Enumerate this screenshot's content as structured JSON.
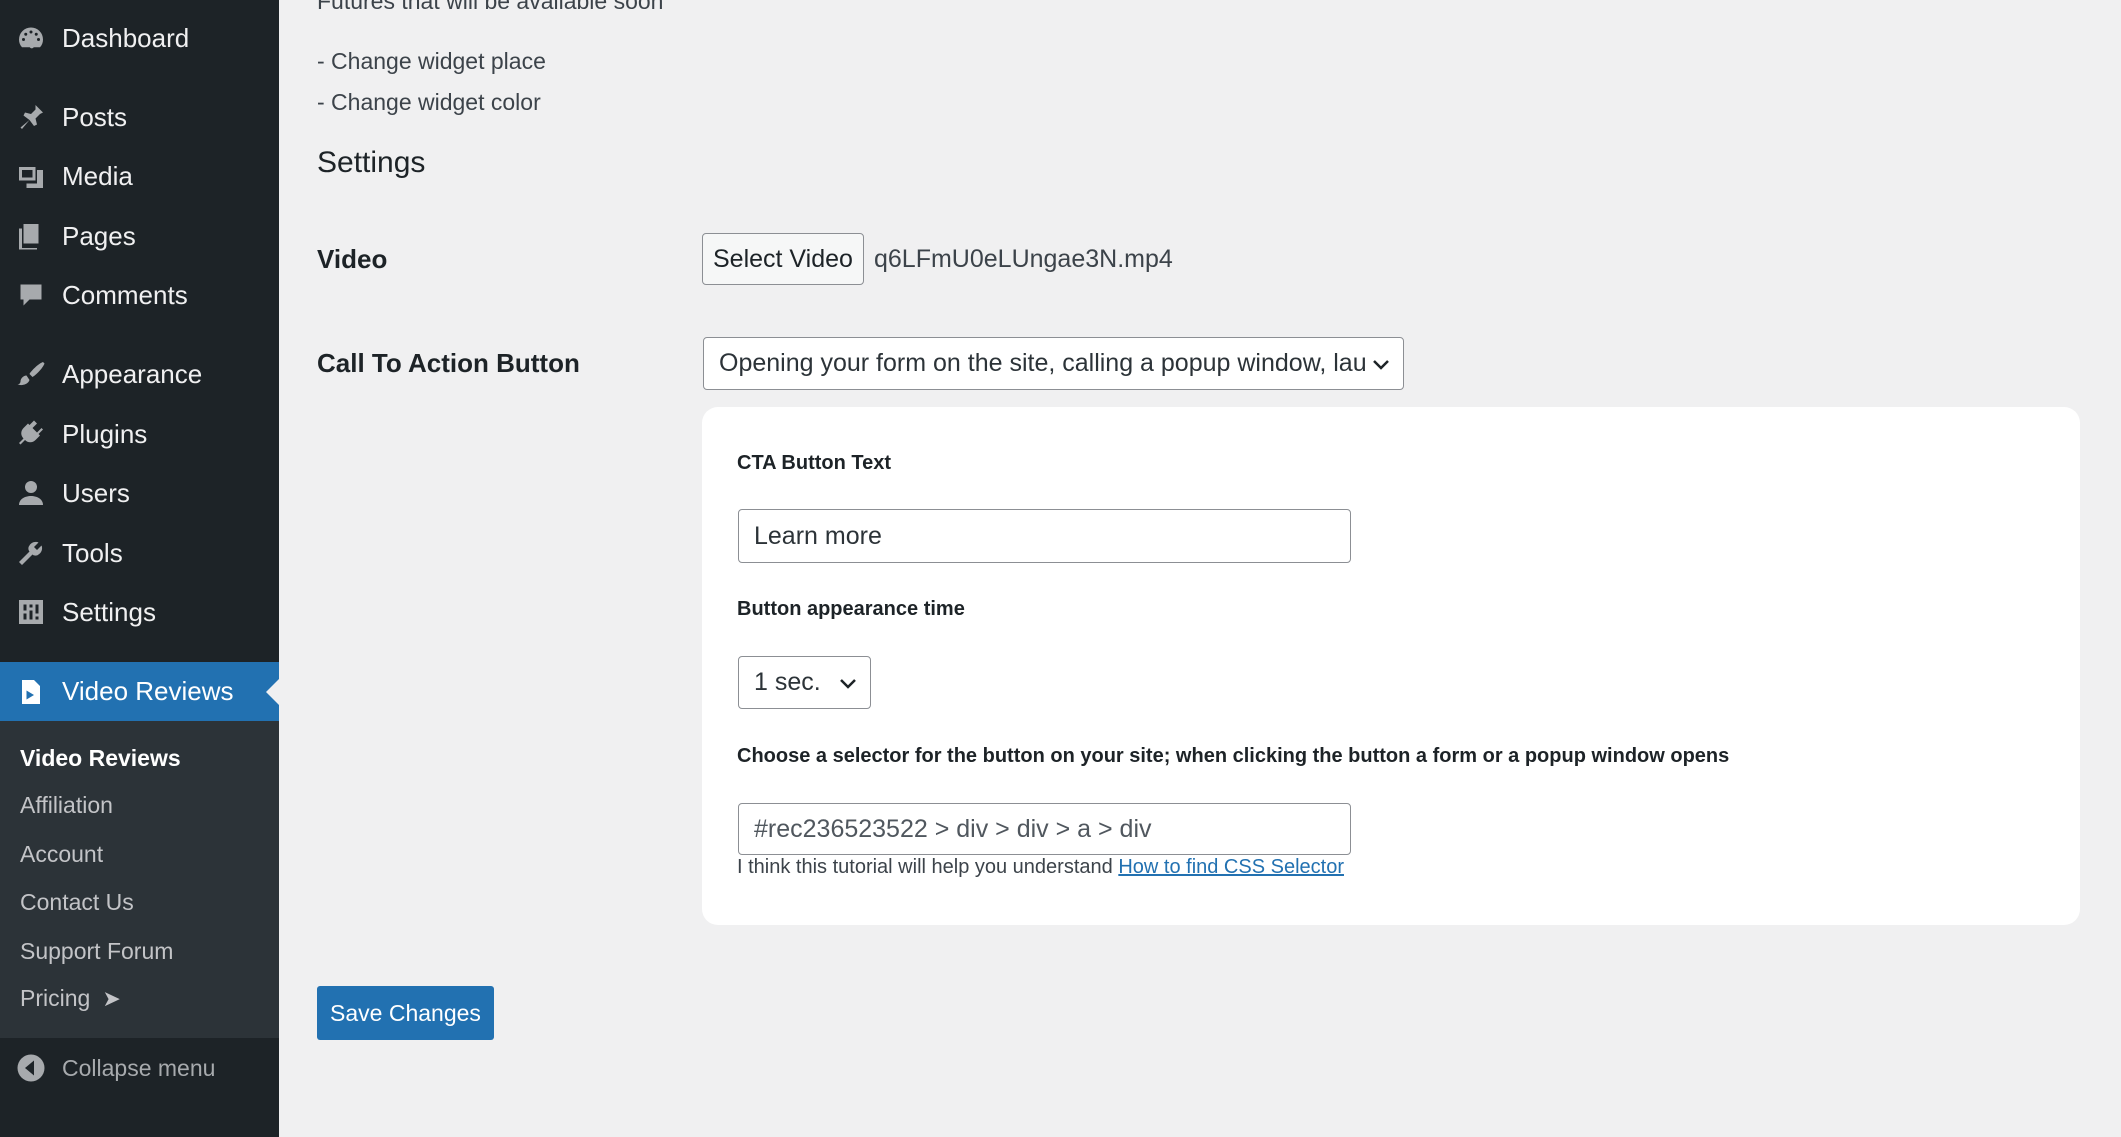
{
  "sidebar": {
    "items": [
      {
        "label": "Dashboard",
        "icon": "dashboard-icon"
      },
      {
        "label": "Posts",
        "icon": "pin-icon"
      },
      {
        "label": "Media",
        "icon": "media-icon"
      },
      {
        "label": "Pages",
        "icon": "pages-icon"
      },
      {
        "label": "Comments",
        "icon": "comment-icon"
      },
      {
        "label": "Appearance",
        "icon": "brush-icon"
      },
      {
        "label": "Plugins",
        "icon": "plugin-icon"
      },
      {
        "label": "Users",
        "icon": "user-icon"
      },
      {
        "label": "Tools",
        "icon": "wrench-icon"
      },
      {
        "label": "Settings",
        "icon": "settings-icon"
      },
      {
        "label": "Video Reviews",
        "icon": "video-file-icon"
      }
    ],
    "submenu": [
      "Video Reviews",
      "Affiliation",
      "Account",
      "Contact Us",
      "Support Forum",
      "Pricing"
    ],
    "pricing_icon": "send-arrow-icon",
    "collapse_label": "Collapse menu"
  },
  "main": {
    "futures_title": "Futures that will be available soon",
    "futures": [
      "- Change widget place",
      "- Change widget color"
    ],
    "settings_title": "Settings",
    "video_label": "Video",
    "select_video_label": "Select Video",
    "video_filename": "q6LFmU0eLUngae3N.mp4",
    "cta_label": "Call To Action Button",
    "cta_selected": "Opening your form on the site, calling a popup window, lau",
    "panel": {
      "cta_text_label": "CTA Button Text",
      "cta_text_value": "Learn more",
      "appearance_label": "Button appearance time",
      "appearance_value": "1 sec.",
      "selector_label": "Choose a selector for the button on your site; when clicking the button a form or a popup window opens",
      "selector_value": "#rec236523522 > div > div > a > div",
      "help_text": "I think this tutorial will help you understand",
      "help_link": "How to find CSS Selector"
    },
    "save_label": "Save Changes"
  },
  "colors": {
    "sidebar_bg": "#1d2327",
    "submenu_bg": "#2c3338",
    "accent": "#2271b1",
    "page_bg": "#f0f0f1"
  }
}
